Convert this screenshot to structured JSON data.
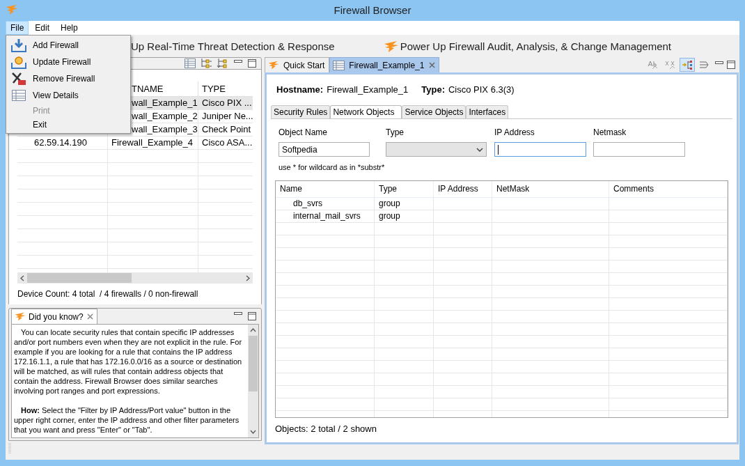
{
  "window": {
    "title": "Firewall Browser"
  },
  "menu_bar": [
    {
      "label": "File",
      "selected": true
    },
    {
      "label": "Edit",
      "selected": false
    },
    {
      "label": "Help",
      "selected": false
    }
  ],
  "file_menu": [
    {
      "label": "Add Firewall",
      "disabled": false
    },
    {
      "label": "Update Firewall",
      "disabled": false
    },
    {
      "label": "Remove Firewall",
      "disabled": false
    },
    {
      "label": "View Details",
      "disabled": false
    },
    {
      "label": "Print",
      "disabled": true
    },
    {
      "label": "Exit",
      "disabled": false
    }
  ],
  "promos": [
    "Up Real-Time Threat Detection & Response",
    "Power Up Firewall Audit, Analysis, & Change Management"
  ],
  "devices_panel": {
    "columns": {
      "column_2": "TNAME",
      "column_3": "TYPE"
    },
    "rows": [
      {
        "column_2": "wall_Example_1",
        "column_3": "Cisco PIX ...",
        "selected": true
      },
      {
        "column_2": "wall_Example_2",
        "column_3": "Juniper Ne...",
        "selected": false
      },
      {
        "column_2": "wall_Example_3",
        "column_3": "Check Point",
        "selected": false
      },
      {
        "column_1": "62.59.14.190",
        "column_2": "Firewall_Example_4",
        "column_3": "Cisco ASA...",
        "selected": false
      }
    ],
    "status": "Device Count: 4 total  / 4 firewalls / 0 non-firewall"
  },
  "tip_panel": {
    "title": "Did you know?",
    "paragraphs": [
      "You can locate security rules that contain specific IP addresses and/or port numbers even when they are not explicit in the rule.  For example if you are looking for a rule that contains the IP address 172.16.1.1, a rule that has 172.16.0.0/16 as a source or destination will be matched, as will rules that contain address objects that contain the address.  Firewall Browser does similar searches involving port ranges and port expressions.",
      "**How:** Select the \"Filter by IP Address/Port value\" button in the upper right corner, enter the IP address and other filter parameters that you want and press \"Enter\" or \"Tab\"."
    ]
  },
  "editor": {
    "tabs": [
      {
        "label": "Quick Start",
        "selected": false
      },
      {
        "label": "Firewall_Example_1",
        "selected": true
      }
    ],
    "toolbar": [
      {
        "selected": false
      },
      {
        "selected": false
      },
      {
        "selected": true
      },
      {
        "selected": false
      }
    ],
    "hostname_label": "Hostname:",
    "hostname": "Firewall_Example_1",
    "type_label": "Type:",
    "type": "Cisco PIX 6.3(3)",
    "subtabs": [
      {
        "label": "Security Rules",
        "selected": false
      },
      {
        "label": "Network Objects",
        "selected": true
      },
      {
        "label": "Service Objects",
        "selected": false
      },
      {
        "label": "Interfaces",
        "selected": false
      }
    ],
    "filters": [
      {
        "label": "Object Name",
        "kind": "text",
        "value": "Softpedia",
        "focused": false
      },
      {
        "label": "Type",
        "kind": "select",
        "disabled": true,
        "focused": false
      },
      {
        "label": "IP Address",
        "kind": "text",
        "focused": true
      },
      {
        "label": "Netmask",
        "kind": "text",
        "focused": false
      }
    ],
    "hint": "use * for wildcard as in *substr*",
    "table": {
      "columns": [
        "Name",
        "Type",
        "IP Address",
        "NetMask",
        "Comments"
      ],
      "rows": [
        [
          "db_svrs",
          "group"
        ],
        [
          "internal_mail_svrs",
          "group"
        ]
      ]
    },
    "status": "Objects: 2 total / 2 shown"
  }
}
